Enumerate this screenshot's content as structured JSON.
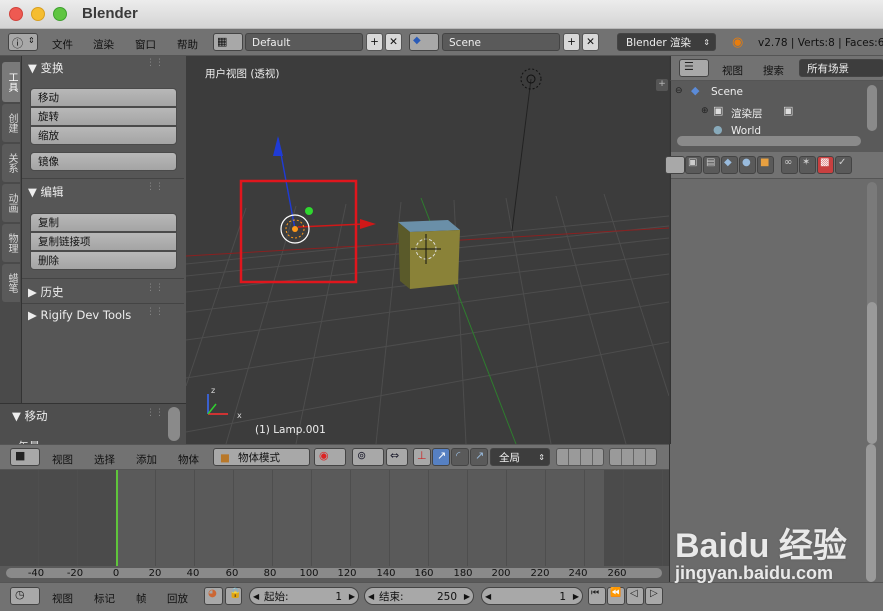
{
  "window": {
    "title": "Blender"
  },
  "info_header": {
    "menus": [
      "文件",
      "渲染",
      "窗口",
      "帮助"
    ],
    "layout": "Default",
    "scene": "Scene",
    "engine": "Blender 渲染",
    "stats": "v2.78 | Verts:8 | Faces:6"
  },
  "tool_tabs": [
    "工具",
    "创建",
    "关系",
    "动画",
    "物理",
    "蜡笔"
  ],
  "tool_panel": {
    "transform_header": "变换",
    "transform_buttons": [
      "移动",
      "旋转",
      "缩放"
    ],
    "mirror": "镜像",
    "edit_header": "编辑",
    "edit_buttons": [
      "复制",
      "复制链接项",
      "删除"
    ],
    "history": "历史",
    "rigify": "Rigify Dev Tools",
    "operator_header": "移动",
    "operator_cut": "矢量"
  },
  "viewport": {
    "label": "用户视图 (透视)",
    "object_label": "(1) Lamp.001",
    "highlight_color": "#e0161d"
  },
  "viewport_header": {
    "menus": [
      "视图",
      "选择",
      "添加",
      "物体"
    ],
    "mode": "物体模式",
    "orientation": "全局"
  },
  "outliner": {
    "menus": [
      "视图",
      "搜索"
    ],
    "filter": "所有场景",
    "items": [
      "Scene",
      "渲染层",
      "World"
    ]
  },
  "timeline": {
    "ticks": [
      "-40",
      "-20",
      "0",
      "20",
      "40",
      "60",
      "80",
      "100",
      "120",
      "140",
      "160",
      "180",
      "200",
      "220",
      "240",
      "260"
    ],
    "current_frame": 0
  },
  "bottom_bar": {
    "menus": [
      "视图",
      "标记",
      "帧",
      "回放"
    ],
    "start_label": "起始:",
    "start_value": "1",
    "end_label": "结束:",
    "end_value": "250",
    "current": "1"
  },
  "watermark": "Baidu 经验 jingyan.baidu.com"
}
